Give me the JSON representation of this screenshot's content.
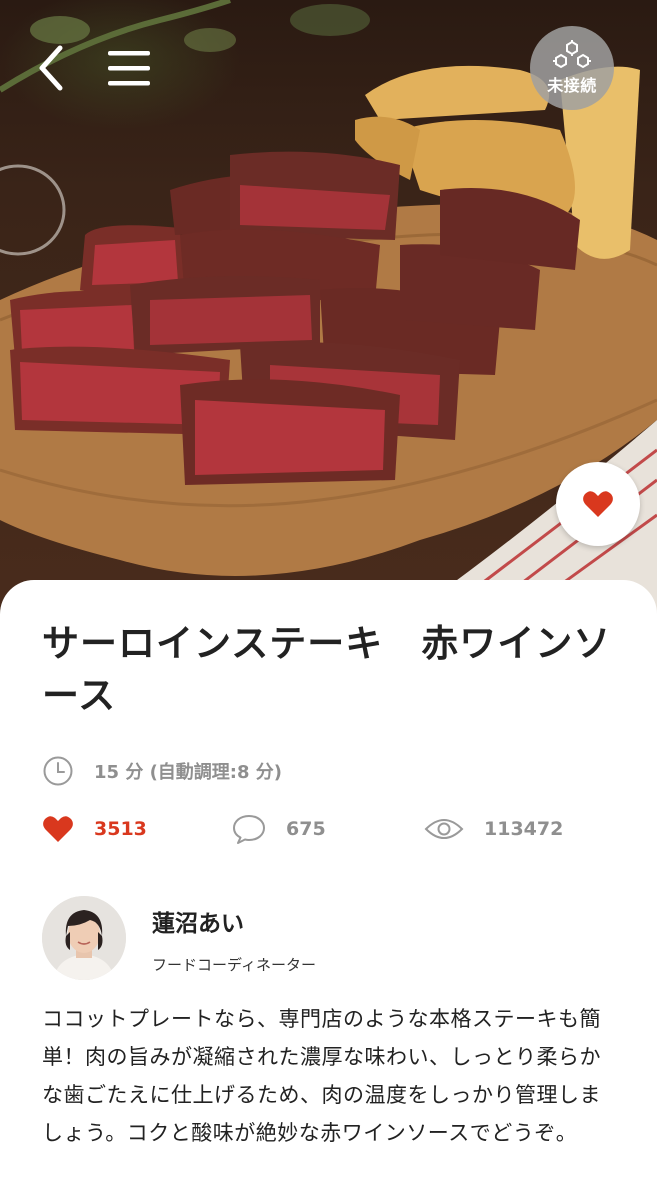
{
  "colors": {
    "accent": "#d9381e",
    "muted": "#8f8f8f",
    "text": "#222222",
    "badge": "#a0a0a0"
  },
  "header": {
    "back_icon": "chevron-left-icon",
    "menu_icon": "hamburger-icon",
    "connection_label": "未接続",
    "connection_icon": "hexagon-cluster-icon"
  },
  "hero": {
    "image_subject": "steak-photo",
    "favorite_icon": "heart-icon"
  },
  "recipe": {
    "title": "サーロインステーキ　赤ワインソース",
    "time": "15 分 (自動調理:8 分)",
    "stats": {
      "likes": "3513",
      "comments": "675",
      "views": "113472"
    },
    "author": {
      "name": "蓮沼あい",
      "role": "フードコーディネーター"
    },
    "description": "ココットプレートなら、専門店のような本格ステーキも簡単！肉の旨みが凝縮された濃厚な味わい、しっとり柔らかな歯ごたえに仕上げるため、肉の温度をしっかり管理しましょう。コクと酸味が絶妙な赤ワインソースでどうぞ。"
  }
}
